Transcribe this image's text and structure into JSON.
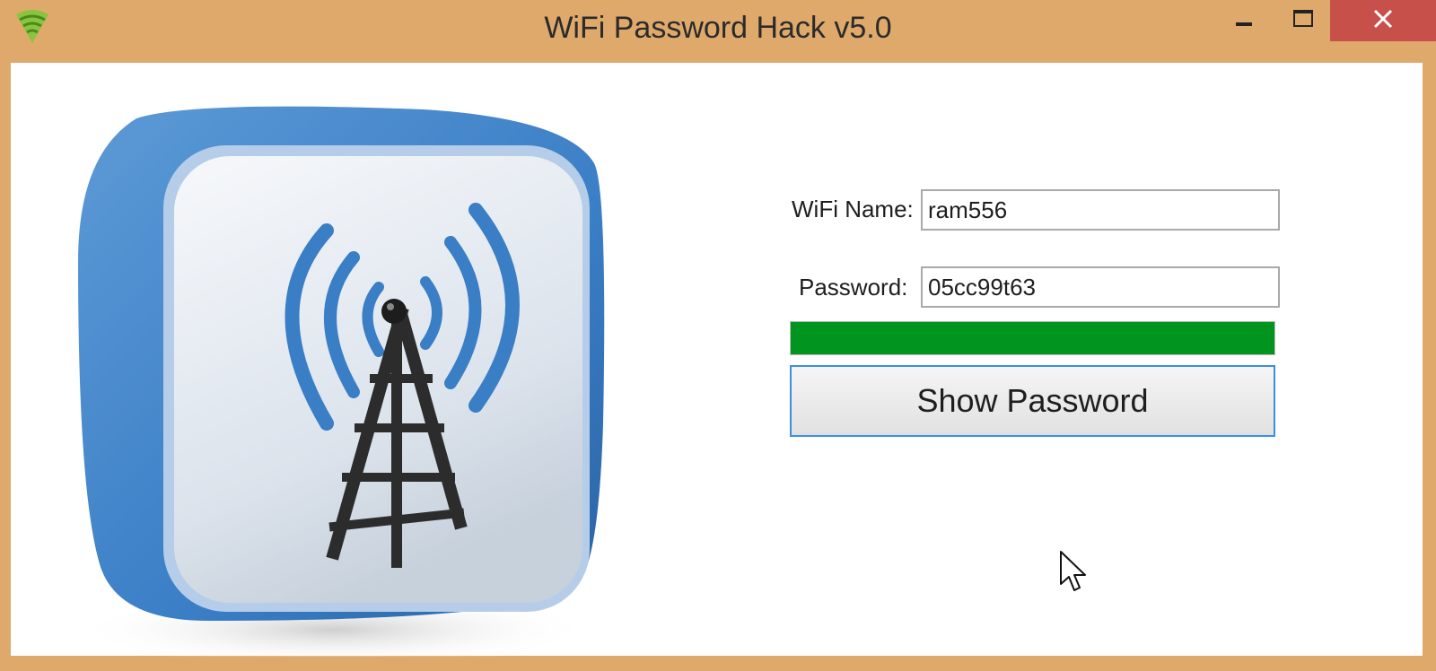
{
  "window": {
    "title": "WiFi Password Hack v5.0",
    "icons": {
      "app": "wifi-fan-icon",
      "minimize": "minimize-icon",
      "maximize": "maximize-icon",
      "close": "close-icon"
    }
  },
  "hero": {
    "icon": "wifi-tower-icon"
  },
  "form": {
    "wifi_name_label": "WiFi Name:",
    "wifi_name_value": "ram556",
    "password_label": "Password:",
    "password_value": "05cc99t63",
    "progress_percent": 100,
    "show_button_label": "Show Password"
  },
  "colors": {
    "frame": "#e0a96c",
    "progress": "#01941f",
    "close_button": "#c7504a",
    "button_focus_border": "#3c8fe0",
    "icon_blue": "#3a7ec6"
  }
}
